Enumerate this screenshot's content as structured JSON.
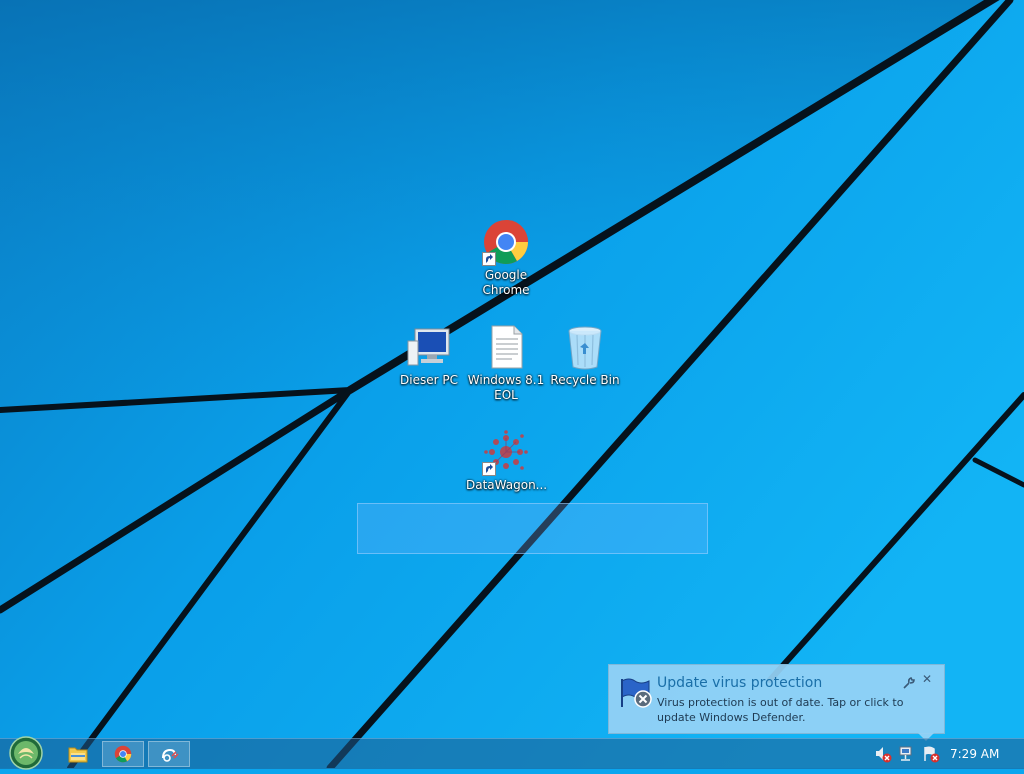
{
  "desktop": {
    "icons": [
      {
        "id": "chrome",
        "label_lines": [
          "Google",
          "Chrome"
        ]
      },
      {
        "id": "this-pc",
        "label_lines": [
          "Dieser PC"
        ]
      },
      {
        "id": "eol-doc",
        "label_lines": [
          "Windows 8.1",
          "EOL"
        ]
      },
      {
        "id": "recycle-bin",
        "label_lines": [
          "Recycle Bin"
        ]
      },
      {
        "id": "datawagon",
        "label_lines": [
          "DataWagon..."
        ]
      }
    ]
  },
  "notification": {
    "title": "Update virus protection",
    "body": "Virus protection is out of date. Tap or click to update Windows Defender.",
    "icon": "defender-flag-icon",
    "close_label": "✕"
  },
  "taskbar": {
    "clock": "7:29 AM",
    "pinned": [
      "start-orb-icon",
      "file-explorer-icon",
      "chrome-icon",
      "datawagon-icon"
    ],
    "tray": [
      "speaker-muted-icon",
      "network-icon",
      "action-center-alert-icon"
    ]
  },
  "colors": {
    "wallpaper": "#0aa6ef",
    "accent": "#1a6fa8"
  }
}
